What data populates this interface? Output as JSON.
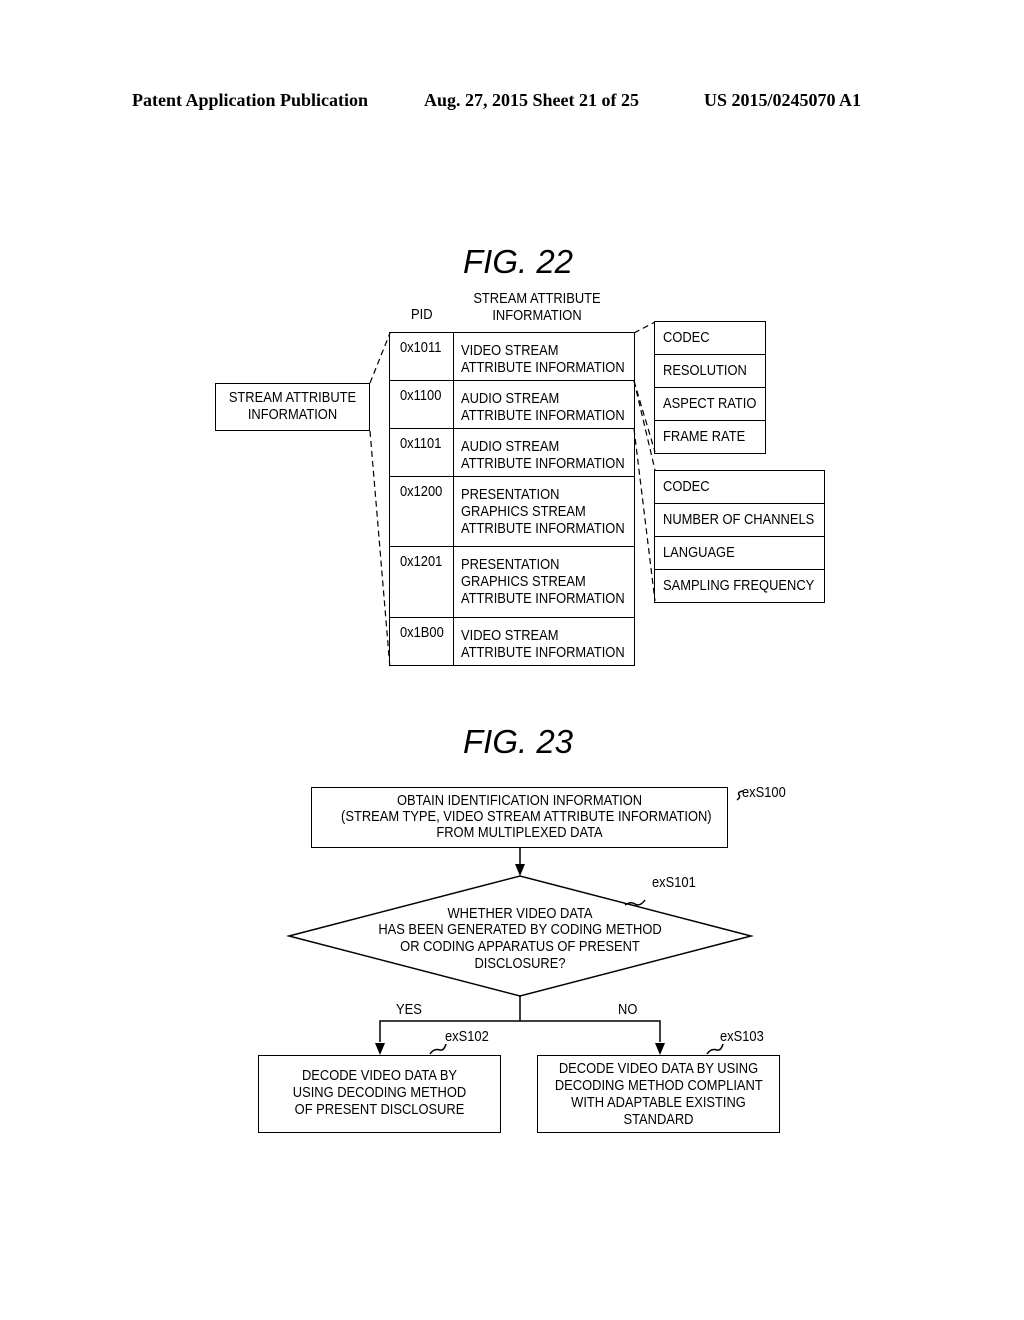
{
  "header": {
    "publication": "Patent Application Publication",
    "date_sheet": "Aug. 27, 2015  Sheet 21 of 25",
    "patent_number": "US 2015/0245070 A1"
  },
  "fig22": {
    "title": "FIG. 22",
    "left_box": [
      "STREAM ATTRIBUTE",
      "INFORMATION"
    ],
    "col_pid": "PID",
    "col_info": [
      "STREAM ATTRIBUTE",
      "INFORMATION"
    ],
    "rows": [
      {
        "pid": "0x1011",
        "info": [
          "VIDEO STREAM",
          "ATTRIBUTE INFORMATION"
        ]
      },
      {
        "pid": "0x1100",
        "info": [
          "AUDIO STREAM",
          "ATTRIBUTE INFORMATION"
        ]
      },
      {
        "pid": "0x1101",
        "info": [
          "AUDIO STREAM",
          "ATTRIBUTE INFORMATION"
        ]
      },
      {
        "pid": "0x1200",
        "info": [
          "PRESENTATION",
          "GRAPHICS STREAM",
          "ATTRIBUTE INFORMATION"
        ]
      },
      {
        "pid": "0x1201",
        "info": [
          "PRESENTATION",
          "GRAPHICS STREAM",
          "ATTRIBUTE INFORMATION"
        ]
      },
      {
        "pid": "0x1B00",
        "info": [
          "VIDEO STREAM",
          "ATTRIBUTE INFORMATION"
        ]
      }
    ],
    "video_attrs": [
      "CODEC",
      "RESOLUTION",
      "ASPECT RATIO",
      "FRAME RATE"
    ],
    "audio_attrs": [
      "CODEC",
      "NUMBER OF CHANNELS",
      "LANGUAGE",
      "SAMPLING FREQUENCY"
    ]
  },
  "fig23": {
    "title": "FIG. 23",
    "s100": {
      "ref": "exS100",
      "lines": [
        "OBTAIN IDENTIFICATION INFORMATION",
        "(STREAM TYPE, VIDEO STREAM ATTRIBUTE INFORMATION)",
        "FROM MULTIPLEXED DATA"
      ]
    },
    "s101": {
      "ref": "exS101",
      "lines": [
        "WHETHER VIDEO DATA",
        "HAS BEEN GENERATED BY CODING METHOD",
        "OR CODING APPARATUS OF PRESENT",
        "DISCLOSURE?"
      ]
    },
    "yes_label": "YES",
    "no_label": "NO",
    "s102": {
      "ref": "exS102",
      "lines": [
        "DECODE VIDEO DATA BY",
        "USING DECODING METHOD",
        "OF PRESENT DISCLOSURE"
      ]
    },
    "s103": {
      "ref": "exS103",
      "lines": [
        "DECODE VIDEO DATA BY USING",
        "DECODING METHOD COMPLIANT",
        "WITH ADAPTABLE EXISTING",
        "STANDARD"
      ]
    }
  }
}
